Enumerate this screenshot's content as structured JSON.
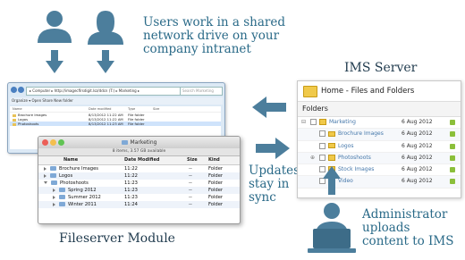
{
  "captions": {
    "users_line1": "Users work in a shared",
    "users_line2": "network drive on your",
    "users_line3": "company intranet",
    "ims_server": "IMS Server",
    "fileserver_module": "Fileserver Module",
    "updates_line1": "Updates",
    "updates_line2": "stay in",
    "updates_line3": "sync",
    "admin_line1": "Administrator",
    "admin_line2": "uploads",
    "admin_line3": "content to IMS"
  },
  "windows_explorer": {
    "address": "▸ Computer ▸ http://imagecflrsdigit.lsz/ddcn (T:) ▸ Marketing ▸",
    "search": "Search Marketing",
    "toolbar": "Organize ▾   Open   Share   New folder",
    "columns": [
      "Name",
      "Date modified",
      "Type",
      "Size"
    ],
    "rows": [
      {
        "name": "Brochure Images",
        "date": "8/13/2012 11:22 AM",
        "type": "File folder"
      },
      {
        "name": "Logos",
        "date": "8/13/2012 11:22 AM",
        "type": "File folder"
      },
      {
        "name": "Photoshoots",
        "date": "8/13/2012 11:23 AM",
        "type": "File folder"
      }
    ]
  },
  "mac_finder": {
    "title": "Marketing",
    "status": "8 items, 3.57 GB available",
    "columns": [
      "Name",
      "Date Modified",
      "Size",
      "Kind"
    ],
    "rows": [
      {
        "name": "Brochure Images",
        "date": "11:22",
        "size": "--",
        "kind": "Folder",
        "level": 0,
        "expanded": false
      },
      {
        "name": "Logos",
        "date": "11:22",
        "size": "--",
        "kind": "Folder",
        "level": 0,
        "expanded": false
      },
      {
        "name": "Photoshoots",
        "date": "11:23",
        "size": "--",
        "kind": "Folder",
        "level": 0,
        "expanded": true
      },
      {
        "name": "Spring 2012",
        "date": "11:23",
        "size": "--",
        "kind": "Folder",
        "level": 1,
        "expanded": false
      },
      {
        "name": "Summer 2012",
        "date": "11:23",
        "size": "--",
        "kind": "Folder",
        "level": 1,
        "expanded": false
      },
      {
        "name": "Winter 2011",
        "date": "11:24",
        "size": "--",
        "kind": "Folder",
        "level": 1,
        "expanded": false
      }
    ]
  },
  "ims_panel": {
    "header": "Home - Files and Folders",
    "folders_title": "Folders",
    "rows": [
      {
        "name": "Marketing",
        "date": "6 Aug 2012",
        "level": 0
      },
      {
        "name": "Brochure Images",
        "date": "6 Aug 2012",
        "level": 1
      },
      {
        "name": "Logos",
        "date": "6 Aug 2012",
        "level": 1
      },
      {
        "name": "Photoshoots",
        "date": "6 Aug 2012",
        "level": 1
      },
      {
        "name": "Stock Images",
        "date": "6 Aug 2012",
        "level": 1
      },
      {
        "name": "Video",
        "date": "6 Aug 2012",
        "level": 1
      }
    ]
  },
  "colors": {
    "icon": "#4c7e9c",
    "caption": "#2a6a88",
    "accent": "#f0c94a"
  },
  "icons": [
    "user-icon",
    "user-female-icon",
    "down-arrow-icon",
    "left-arrow-icon",
    "right-arrow-icon",
    "up-arrow-icon",
    "admin-laptop-icon"
  ]
}
